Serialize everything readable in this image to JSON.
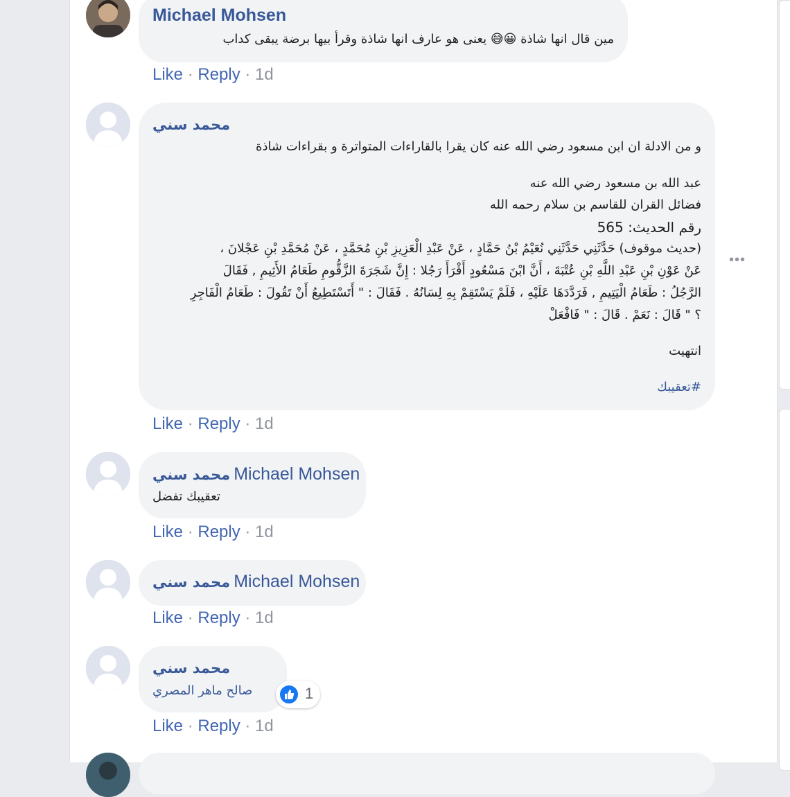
{
  "comments": [
    {
      "author": "Michael Mohsen",
      "text": "مين قال انها شاذة 😀😅 يعنى هو عارف انها شاذة وقرأ بيها برضة يبقى كداب",
      "actions": {
        "like": "Like",
        "reply": "Reply",
        "time": "1d"
      }
    },
    {
      "author": "محمد سني",
      "lines": [
        "و من الادلة ان ابن مسعود رضي الله عنه كان يقرا بالقاراءات المتواترة و بقراءات شاذة",
        "عبد الله بن مسعود رضي الله عنه",
        "فضائل القران للقاسم بن سلام رحمه الله",
        "رقم الحديث: 565",
        "(حديث موقوف) حَدَّثَنِي حَدَّثَنِي نُعَيْمُ بْنُ حَمَّادٍ ، عَنْ عَبْدِ الْعَزِيزِ بْنِ مُحَمَّدٍ ، عَنْ مُحَمَّدِ بْنِ عَجْلانَ ،",
        "عَنْ عَوْنِ بْنِ عَبْدِ اللَّهِ بْنِ عُتْبَةَ ، أَنَّ ابْنَ مَسْعُودٍ أَقْرَأَ رَجُلا : إِنَّ شَجَرَةَ الزَّقُّومِ طَعَامُ الأَثِيمِ , فَقَالَ",
        "الرَّجُلُ : طَعَامُ الْيَتِيمِ , فَرَدَّدَهَا عَلَيْهِ ، فَلَمْ يَسْتَقِمْ بِهِ لِسَانُهُ . فَقَالَ : \" أَتَسْتَطِيعُ أَنْ تَقُولَ : طَعَامُ الْفَاجِرِ",
        "؟ \" قَالَ : نَعَمْ . قَالَ : \" فَافْعَلْ",
        "انتهيت"
      ],
      "hashtag": "#تعقيبك",
      "actions": {
        "like": "Like",
        "reply": "Reply",
        "time": "1d"
      }
    },
    {
      "author": "محمد سني",
      "mention": "Michael Mohsen",
      "text": "تعقيبك تفضل",
      "actions": {
        "like": "Like",
        "reply": "Reply",
        "time": "1d"
      }
    },
    {
      "author": "محمد سني",
      "mention": "Michael Mohsen",
      "actions": {
        "like": "Like",
        "reply": "Reply",
        "time": "1d"
      }
    },
    {
      "author": "محمد سني",
      "text": "صالح ماهر المصري",
      "reaction_count": "1",
      "actions": {
        "like": "Like",
        "reply": "Reply",
        "time": "1d"
      }
    }
  ],
  "separator": " · ",
  "more_icon": "more-options-icon",
  "colors": {
    "link": "#385898",
    "action": "#4267b2",
    "bubble": "#f2f3f5"
  }
}
